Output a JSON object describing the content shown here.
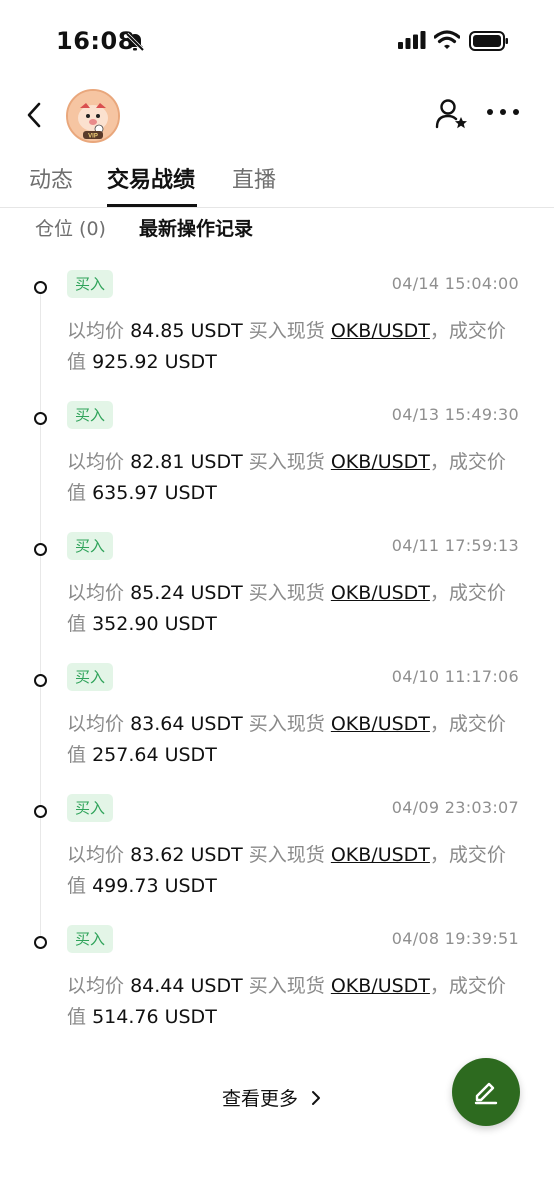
{
  "status_bar": {
    "time": "16:08"
  },
  "tabs": [
    {
      "label": "动态"
    },
    {
      "label": "交易战绩"
    },
    {
      "label": "直播"
    }
  ],
  "subtabs": [
    {
      "label": "仓位 (0)"
    },
    {
      "label": "最新操作记录"
    }
  ],
  "labels": {
    "prefix": "以均价",
    "mid": "买入现货",
    "suffix": "，成交价",
    "value_prefix": "值",
    "unit": "USDT"
  },
  "records": [
    {
      "action": "买入",
      "time": "04/14 15:04:00",
      "price": "84.85",
      "pair": "OKB/USDT",
      "value": "925.92"
    },
    {
      "action": "买入",
      "time": "04/13 15:49:30",
      "price": "82.81",
      "pair": "OKB/USDT",
      "value": "635.97"
    },
    {
      "action": "买入",
      "time": "04/11 17:59:13",
      "price": "85.24",
      "pair": "OKB/USDT",
      "value": "352.90"
    },
    {
      "action": "买入",
      "time": "04/10 11:17:06",
      "price": "83.64",
      "pair": "OKB/USDT",
      "value": "257.64"
    },
    {
      "action": "买入",
      "time": "04/09 23:03:07",
      "price": "83.62",
      "pair": "OKB/USDT",
      "value": "499.73"
    },
    {
      "action": "买入",
      "time": "04/08 19:39:51",
      "price": "84.44",
      "pair": "OKB/USDT",
      "value": "514.76"
    }
  ],
  "see_more": "查看更多",
  "avatar": {
    "badge": "VIP"
  },
  "colors": {
    "accent_green": "#2fa35a",
    "badge_bg": "#e3f5e7",
    "fab": "#2d6a1f"
  }
}
